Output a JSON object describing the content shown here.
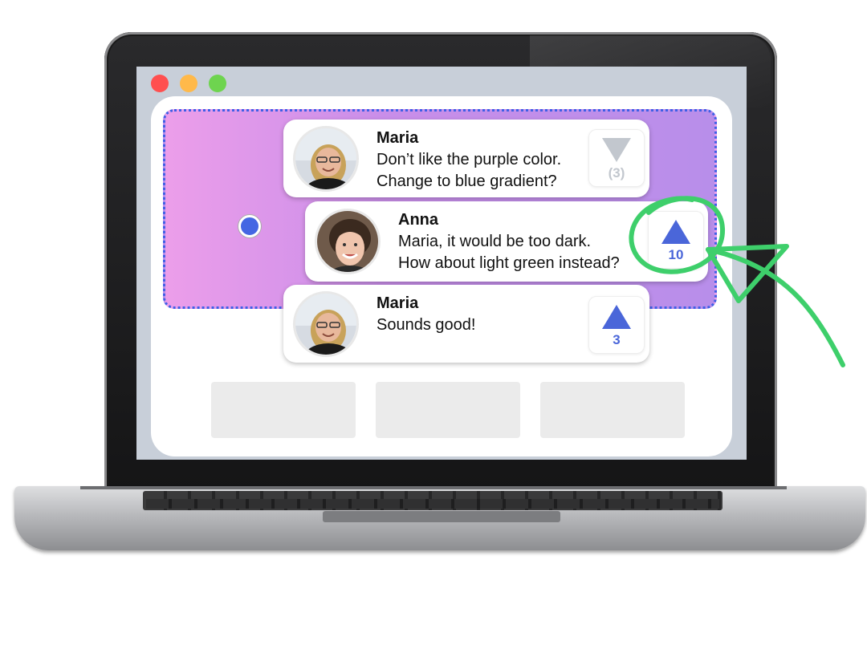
{
  "window": {
    "controls": [
      "close",
      "minimize",
      "zoom"
    ],
    "control_colors": {
      "close": "#ff4f4f",
      "minimize": "#ffb94a",
      "zoom": "#6ed44f"
    }
  },
  "theme": {
    "selection_gradient": [
      "#ec9eea",
      "#b88eea"
    ],
    "selection_border": "#3e5fe6",
    "vote_active_color": "#4a66d9",
    "vote_inactive_color": "#c2c7ce",
    "annotation_color": "#3ecf6b"
  },
  "messages": [
    {
      "author": "Maria",
      "line1": "Don’t like the purple color.",
      "line2": "Change to blue gradient?",
      "vote_direction": "down",
      "vote_count": "(3)",
      "icon": "triangle-down-icon"
    },
    {
      "author": "Anna",
      "line1": "Maria, it would be too dark.",
      "line2": "How about light green instead?",
      "vote_direction": "up",
      "vote_count": "10",
      "icon": "triangle-up-icon"
    },
    {
      "author": "Maria",
      "line1": "Sounds good!",
      "line2": "",
      "vote_direction": "up",
      "vote_count": "3",
      "icon": "triangle-up-icon"
    }
  ],
  "placeholders": 3,
  "annotation": {
    "type": "hand-drawn-circle-with-arrow",
    "target": "vote-count-10"
  }
}
